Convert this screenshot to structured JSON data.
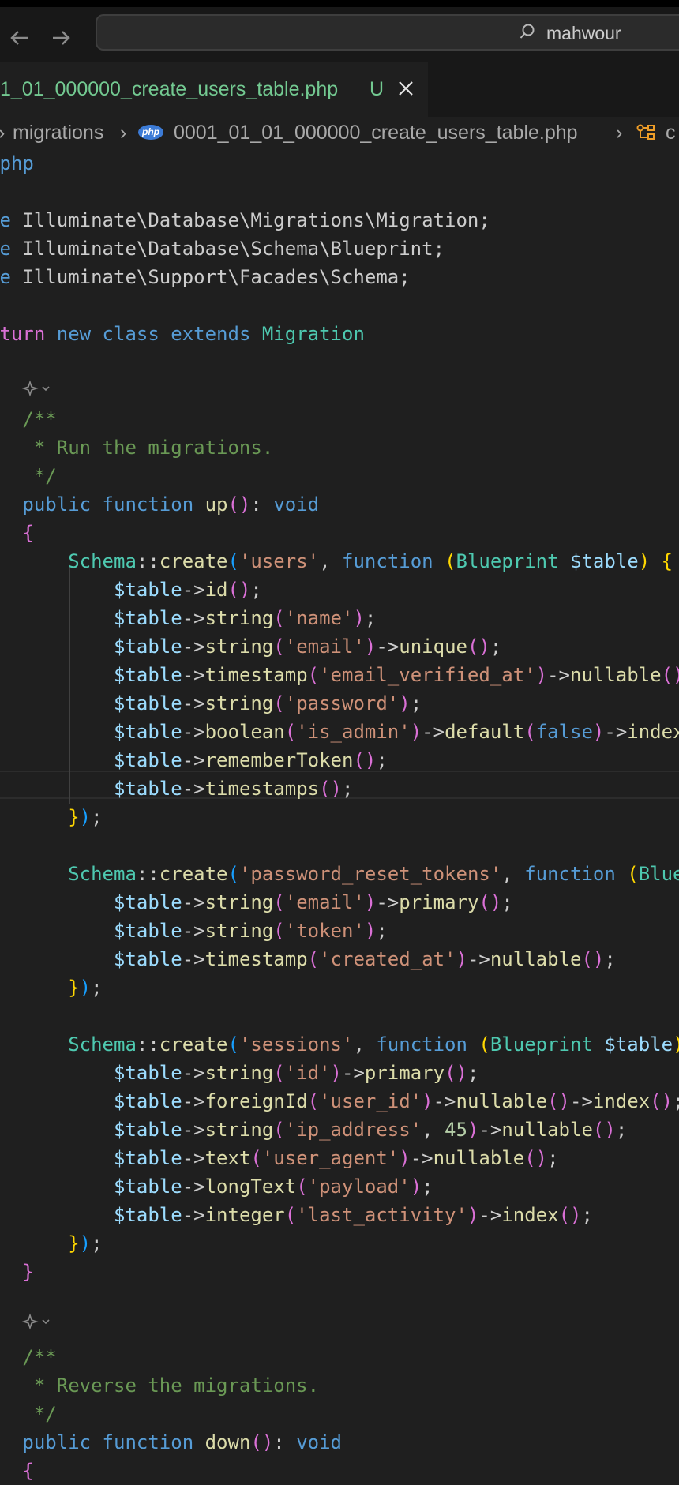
{
  "search": {
    "text": "mahwour"
  },
  "tab": {
    "label": "1_01_000000_create_users_table.php",
    "status": "U"
  },
  "breadcrumb": {
    "folder": "migrations",
    "file": "0001_01_01_000000_create_users_table.php",
    "php_badge": "php",
    "symbol": "c"
  },
  "code": [
    {
      "segs": [
        {
          "t": "php",
          "c": "kw"
        }
      ]
    },
    {
      "segs": []
    },
    {
      "segs": [
        {
          "t": "e ",
          "c": "kw"
        },
        {
          "t": "Illuminate\\Database\\Migrations\\Migration;",
          "c": "txt"
        }
      ]
    },
    {
      "segs": [
        {
          "t": "e ",
          "c": "kw"
        },
        {
          "t": "Illuminate\\Database\\Schema\\Blueprint;",
          "c": "txt"
        }
      ]
    },
    {
      "segs": [
        {
          "t": "e ",
          "c": "kw"
        },
        {
          "t": "Illuminate\\Support\\Facades\\Schema;",
          "c": "txt"
        }
      ]
    },
    {
      "segs": []
    },
    {
      "segs": [
        {
          "t": "turn ",
          "c": "p2"
        },
        {
          "t": "new ",
          "c": "kw"
        },
        {
          "t": "class ",
          "c": "kw"
        },
        {
          "t": "extends ",
          "c": "kw"
        },
        {
          "t": "Migration",
          "c": "ty"
        }
      ]
    },
    {
      "segs": []
    },
    {
      "segs": []
    },
    {
      "segs": [
        {
          "t": "  /**",
          "c": "cm"
        }
      ]
    },
    {
      "segs": [
        {
          "t": "   * Run the migrations.",
          "c": "cm"
        }
      ]
    },
    {
      "segs": [
        {
          "t": "   */",
          "c": "cm"
        }
      ]
    },
    {
      "segs": [
        {
          "t": "  public ",
          "c": "kw"
        },
        {
          "t": "function ",
          "c": "kw"
        },
        {
          "t": "up",
          "c": "fn"
        },
        {
          "t": "()",
          "c": "p2"
        },
        {
          "t": ": ",
          "c": "txt"
        },
        {
          "t": "void",
          "c": "kw"
        }
      ]
    },
    {
      "segs": [
        {
          "t": "  {",
          "c": "p2"
        }
      ]
    },
    {
      "segs": [
        {
          "t": "      Schema",
          "c": "ty"
        },
        {
          "t": "::",
          "c": "txt"
        },
        {
          "t": "create",
          "c": "fn"
        },
        {
          "t": "(",
          "c": "p3"
        },
        {
          "t": "'users'",
          "c": "str"
        },
        {
          "t": ", ",
          "c": "txt"
        },
        {
          "t": "function ",
          "c": "kw"
        },
        {
          "t": "(",
          "c": "p1"
        },
        {
          "t": "Blueprint ",
          "c": "ty"
        },
        {
          "t": "$table",
          "c": "var"
        },
        {
          "t": ") ",
          "c": "p1"
        },
        {
          "t": "{",
          "c": "p1"
        }
      ]
    },
    {
      "segs": [
        {
          "t": "          $table",
          "c": "var"
        },
        {
          "t": "->",
          "c": "txt"
        },
        {
          "t": "id",
          "c": "fn"
        },
        {
          "t": "()",
          "c": "p2"
        },
        {
          "t": ";",
          "c": "txt"
        }
      ]
    },
    {
      "segs": [
        {
          "t": "          $table",
          "c": "var"
        },
        {
          "t": "->",
          "c": "txt"
        },
        {
          "t": "string",
          "c": "fn"
        },
        {
          "t": "(",
          "c": "p2"
        },
        {
          "t": "'name'",
          "c": "str"
        },
        {
          "t": ")",
          "c": "p2"
        },
        {
          "t": ";",
          "c": "txt"
        }
      ]
    },
    {
      "segs": [
        {
          "t": "          $table",
          "c": "var"
        },
        {
          "t": "->",
          "c": "txt"
        },
        {
          "t": "string",
          "c": "fn"
        },
        {
          "t": "(",
          "c": "p2"
        },
        {
          "t": "'email'",
          "c": "str"
        },
        {
          "t": ")",
          "c": "p2"
        },
        {
          "t": "->",
          "c": "txt"
        },
        {
          "t": "unique",
          "c": "fn"
        },
        {
          "t": "()",
          "c": "p2"
        },
        {
          "t": ";",
          "c": "txt"
        }
      ]
    },
    {
      "segs": [
        {
          "t": "          $table",
          "c": "var"
        },
        {
          "t": "->",
          "c": "txt"
        },
        {
          "t": "timestamp",
          "c": "fn"
        },
        {
          "t": "(",
          "c": "p2"
        },
        {
          "t": "'email_verified_at'",
          "c": "str"
        },
        {
          "t": ")",
          "c": "p2"
        },
        {
          "t": "->",
          "c": "txt"
        },
        {
          "t": "nullable",
          "c": "fn"
        },
        {
          "t": "()",
          "c": "p2"
        }
      ]
    },
    {
      "segs": [
        {
          "t": "          $table",
          "c": "var"
        },
        {
          "t": "->",
          "c": "txt"
        },
        {
          "t": "string",
          "c": "fn"
        },
        {
          "t": "(",
          "c": "p2"
        },
        {
          "t": "'password'",
          "c": "str"
        },
        {
          "t": ")",
          "c": "p2"
        },
        {
          "t": ";",
          "c": "txt"
        }
      ]
    },
    {
      "segs": [
        {
          "t": "          $table",
          "c": "var"
        },
        {
          "t": "->",
          "c": "txt"
        },
        {
          "t": "boolean",
          "c": "fn"
        },
        {
          "t": "(",
          "c": "p2"
        },
        {
          "t": "'is_admin'",
          "c": "str"
        },
        {
          "t": ")",
          "c": "p2"
        },
        {
          "t": "->",
          "c": "txt"
        },
        {
          "t": "default",
          "c": "fn"
        },
        {
          "t": "(",
          "c": "p2"
        },
        {
          "t": "false",
          "c": "kw"
        },
        {
          "t": ")",
          "c": "p2"
        },
        {
          "t": "->",
          "c": "txt"
        },
        {
          "t": "index",
          "c": "fn"
        }
      ]
    },
    {
      "segs": [
        {
          "t": "          $table",
          "c": "var"
        },
        {
          "t": "->",
          "c": "txt"
        },
        {
          "t": "rememberToken",
          "c": "fn"
        },
        {
          "t": "()",
          "c": "p2"
        },
        {
          "t": ";",
          "c": "txt"
        }
      ]
    },
    {
      "segs": [
        {
          "t": "          $table",
          "c": "var"
        },
        {
          "t": "->",
          "c": "txt"
        },
        {
          "t": "timestamps",
          "c": "fn"
        },
        {
          "t": "()",
          "c": "p2"
        },
        {
          "t": ";",
          "c": "txt"
        }
      ]
    },
    {
      "segs": [
        {
          "t": "      }",
          "c": "p1"
        },
        {
          "t": ")",
          "c": "p3"
        },
        {
          "t": ";",
          "c": "txt"
        }
      ]
    },
    {
      "segs": []
    },
    {
      "segs": [
        {
          "t": "      Schema",
          "c": "ty"
        },
        {
          "t": "::",
          "c": "txt"
        },
        {
          "t": "create",
          "c": "fn"
        },
        {
          "t": "(",
          "c": "p3"
        },
        {
          "t": "'password_reset_tokens'",
          "c": "str"
        },
        {
          "t": ", ",
          "c": "txt"
        },
        {
          "t": "function ",
          "c": "kw"
        },
        {
          "t": "(",
          "c": "p1"
        },
        {
          "t": "Blue",
          "c": "ty"
        }
      ]
    },
    {
      "segs": [
        {
          "t": "          $table",
          "c": "var"
        },
        {
          "t": "->",
          "c": "txt"
        },
        {
          "t": "string",
          "c": "fn"
        },
        {
          "t": "(",
          "c": "p2"
        },
        {
          "t": "'email'",
          "c": "str"
        },
        {
          "t": ")",
          "c": "p2"
        },
        {
          "t": "->",
          "c": "txt"
        },
        {
          "t": "primary",
          "c": "fn"
        },
        {
          "t": "()",
          "c": "p2"
        },
        {
          "t": ";",
          "c": "txt"
        }
      ]
    },
    {
      "segs": [
        {
          "t": "          $table",
          "c": "var"
        },
        {
          "t": "->",
          "c": "txt"
        },
        {
          "t": "string",
          "c": "fn"
        },
        {
          "t": "(",
          "c": "p2"
        },
        {
          "t": "'token'",
          "c": "str"
        },
        {
          "t": ")",
          "c": "p2"
        },
        {
          "t": ";",
          "c": "txt"
        }
      ]
    },
    {
      "segs": [
        {
          "t": "          $table",
          "c": "var"
        },
        {
          "t": "->",
          "c": "txt"
        },
        {
          "t": "timestamp",
          "c": "fn"
        },
        {
          "t": "(",
          "c": "p2"
        },
        {
          "t": "'created_at'",
          "c": "str"
        },
        {
          "t": ")",
          "c": "p2"
        },
        {
          "t": "->",
          "c": "txt"
        },
        {
          "t": "nullable",
          "c": "fn"
        },
        {
          "t": "()",
          "c": "p2"
        },
        {
          "t": ";",
          "c": "txt"
        }
      ]
    },
    {
      "segs": [
        {
          "t": "      }",
          "c": "p1"
        },
        {
          "t": ")",
          "c": "p3"
        },
        {
          "t": ";",
          "c": "txt"
        }
      ]
    },
    {
      "segs": []
    },
    {
      "segs": [
        {
          "t": "      Schema",
          "c": "ty"
        },
        {
          "t": "::",
          "c": "txt"
        },
        {
          "t": "create",
          "c": "fn"
        },
        {
          "t": "(",
          "c": "p3"
        },
        {
          "t": "'sessions'",
          "c": "str"
        },
        {
          "t": ", ",
          "c": "txt"
        },
        {
          "t": "function ",
          "c": "kw"
        },
        {
          "t": "(",
          "c": "p1"
        },
        {
          "t": "Blueprint ",
          "c": "ty"
        },
        {
          "t": "$table",
          "c": "var"
        },
        {
          "t": ")",
          "c": "p1"
        }
      ]
    },
    {
      "segs": [
        {
          "t": "          $table",
          "c": "var"
        },
        {
          "t": "->",
          "c": "txt"
        },
        {
          "t": "string",
          "c": "fn"
        },
        {
          "t": "(",
          "c": "p2"
        },
        {
          "t": "'id'",
          "c": "str"
        },
        {
          "t": ")",
          "c": "p2"
        },
        {
          "t": "->",
          "c": "txt"
        },
        {
          "t": "primary",
          "c": "fn"
        },
        {
          "t": "()",
          "c": "p2"
        },
        {
          "t": ";",
          "c": "txt"
        }
      ]
    },
    {
      "segs": [
        {
          "t": "          $table",
          "c": "var"
        },
        {
          "t": "->",
          "c": "txt"
        },
        {
          "t": "foreignId",
          "c": "fn"
        },
        {
          "t": "(",
          "c": "p2"
        },
        {
          "t": "'user_id'",
          "c": "str"
        },
        {
          "t": ")",
          "c": "p2"
        },
        {
          "t": "->",
          "c": "txt"
        },
        {
          "t": "nullable",
          "c": "fn"
        },
        {
          "t": "()",
          "c": "p2"
        },
        {
          "t": "->",
          "c": "txt"
        },
        {
          "t": "index",
          "c": "fn"
        },
        {
          "t": "()",
          "c": "p2"
        },
        {
          "t": ";",
          "c": "txt"
        }
      ]
    },
    {
      "segs": [
        {
          "t": "          $table",
          "c": "var"
        },
        {
          "t": "->",
          "c": "txt"
        },
        {
          "t": "string",
          "c": "fn"
        },
        {
          "t": "(",
          "c": "p2"
        },
        {
          "t": "'ip_address'",
          "c": "str"
        },
        {
          "t": ", ",
          "c": "txt"
        },
        {
          "t": "45",
          "c": "num"
        },
        {
          "t": ")",
          "c": "p2"
        },
        {
          "t": "->",
          "c": "txt"
        },
        {
          "t": "nullable",
          "c": "fn"
        },
        {
          "t": "()",
          "c": "p2"
        },
        {
          "t": ";",
          "c": "txt"
        }
      ]
    },
    {
      "segs": [
        {
          "t": "          $table",
          "c": "var"
        },
        {
          "t": "->",
          "c": "txt"
        },
        {
          "t": "text",
          "c": "fn"
        },
        {
          "t": "(",
          "c": "p2"
        },
        {
          "t": "'user_agent'",
          "c": "str"
        },
        {
          "t": ")",
          "c": "p2"
        },
        {
          "t": "->",
          "c": "txt"
        },
        {
          "t": "nullable",
          "c": "fn"
        },
        {
          "t": "()",
          "c": "p2"
        },
        {
          "t": ";",
          "c": "txt"
        }
      ]
    },
    {
      "segs": [
        {
          "t": "          $table",
          "c": "var"
        },
        {
          "t": "->",
          "c": "txt"
        },
        {
          "t": "longText",
          "c": "fn"
        },
        {
          "t": "(",
          "c": "p2"
        },
        {
          "t": "'payload'",
          "c": "str"
        },
        {
          "t": ")",
          "c": "p2"
        },
        {
          "t": ";",
          "c": "txt"
        }
      ]
    },
    {
      "segs": [
        {
          "t": "          $table",
          "c": "var"
        },
        {
          "t": "->",
          "c": "txt"
        },
        {
          "t": "integer",
          "c": "fn"
        },
        {
          "t": "(",
          "c": "p2"
        },
        {
          "t": "'last_activity'",
          "c": "str"
        },
        {
          "t": ")",
          "c": "p2"
        },
        {
          "t": "->",
          "c": "txt"
        },
        {
          "t": "index",
          "c": "fn"
        },
        {
          "t": "()",
          "c": "p2"
        },
        {
          "t": ";",
          "c": "txt"
        }
      ]
    },
    {
      "segs": [
        {
          "t": "      }",
          "c": "p1"
        },
        {
          "t": ")",
          "c": "p3"
        },
        {
          "t": ";",
          "c": "txt"
        }
      ]
    },
    {
      "segs": [
        {
          "t": "  }",
          "c": "p2"
        }
      ]
    },
    {
      "segs": []
    },
    {
      "segs": []
    },
    {
      "segs": [
        {
          "t": "  /**",
          "c": "cm"
        }
      ]
    },
    {
      "segs": [
        {
          "t": "   * Reverse the migrations.",
          "c": "cm"
        }
      ]
    },
    {
      "segs": [
        {
          "t": "   */",
          "c": "cm"
        }
      ]
    },
    {
      "segs": [
        {
          "t": "  public ",
          "c": "kw"
        },
        {
          "t": "function ",
          "c": "kw"
        },
        {
          "t": "down",
          "c": "fn"
        },
        {
          "t": "()",
          "c": "p2"
        },
        {
          "t": ": ",
          "c": "txt"
        },
        {
          "t": "void",
          "c": "kw"
        }
      ]
    },
    {
      "segs": [
        {
          "t": "  {",
          "c": "p2"
        }
      ]
    }
  ]
}
